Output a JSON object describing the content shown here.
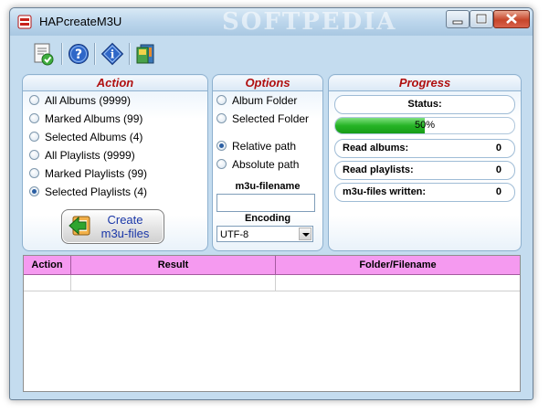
{
  "window": {
    "title": "HAPcreateM3U",
    "watermark": "SOFTPEDIA"
  },
  "toolbar": {
    "icons": [
      "document-check-icon",
      "help-icon",
      "info-icon",
      "image-icon"
    ]
  },
  "action": {
    "title": "Action",
    "options": [
      {
        "label": "All Albums (9999)",
        "checked": false
      },
      {
        "label": "Marked Albums (99)",
        "checked": false
      },
      {
        "label": "Selected Albums (4)",
        "checked": false
      },
      {
        "label": "All Playlists (9999)",
        "checked": false
      },
      {
        "label": "Marked Playlists (99)",
        "checked": false
      },
      {
        "label": "Selected Playlists (4)",
        "checked": true
      }
    ],
    "create_label_1": "Create",
    "create_label_2": "m3u-files"
  },
  "options": {
    "title": "Options",
    "folder_album": "Album Folder",
    "folder_selected": "Selected Folder",
    "path_relative": "Relative path",
    "path_absolute": "Absolute path",
    "filename_label": "m3u-filename",
    "filename_value": "",
    "encoding_label": "Encoding",
    "encoding_value": "UTF-8"
  },
  "progress": {
    "title": "Progress",
    "status_label": "Status:",
    "percent": "50%",
    "percent_value": 50,
    "read_albums_label": "Read albums:",
    "read_albums_value": "0",
    "read_playlists_label": "Read playlists:",
    "read_playlists_value": "0",
    "written_label": "m3u-files written:",
    "written_value": "0"
  },
  "grid": {
    "headers": [
      "Action",
      "Result",
      "Folder/Filename"
    ]
  },
  "colors": {
    "panel_title": "#b01010",
    "grid_header": "#f59af0",
    "progress_fill": "#26b426",
    "create_text": "#1a37a8"
  }
}
